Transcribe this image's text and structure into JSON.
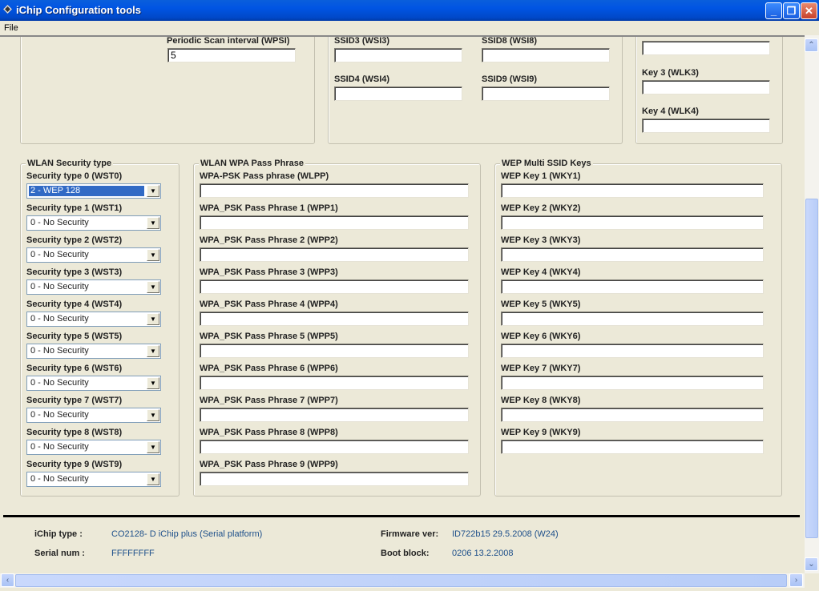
{
  "window": {
    "title": "iChip Configuration tools",
    "minimize": "_",
    "maximize": "❐",
    "close": "✕"
  },
  "menu": {
    "file": "File"
  },
  "top": {
    "scan_label": "Periodic Scan interval (WPSI)",
    "scan_value": "5",
    "ssid3": "SSID3 (WSI3)",
    "ssid8": "SSID8 (WSI8)",
    "ssid4": "SSID4 (WSI4)",
    "ssid9": "SSID9 (WSI9)",
    "key3": "Key 3 (WLK3)",
    "key4": "Key 4 (WLK4)"
  },
  "security": {
    "title": "WLAN Security type",
    "items": [
      {
        "label": "Security type 0 (WST0)",
        "value": "2 - WEP 128"
      },
      {
        "label": "Security type 1 (WST1)",
        "value": "0 - No Security"
      },
      {
        "label": "Security type 2 (WST2)",
        "value": "0 - No Security"
      },
      {
        "label": "Security type 3 (WST3)",
        "value": "0 - No Security"
      },
      {
        "label": "Security type 4 (WST4)",
        "value": "0 - No Security"
      },
      {
        "label": "Security type 5 (WST5)",
        "value": "0 - No Security"
      },
      {
        "label": "Security type 6 (WST6)",
        "value": "0 - No Security"
      },
      {
        "label": "Security type 7 (WST7)",
        "value": "0 - No Security"
      },
      {
        "label": "Security type 8 (WST8)",
        "value": "0 - No Security"
      },
      {
        "label": "Security type 9 (WST9)",
        "value": "0 - No Security"
      }
    ]
  },
  "wpa": {
    "title": "WLAN WPA Pass Phrase",
    "items": [
      {
        "label": "WPA-PSK Pass phrase (WLPP)",
        "value": ""
      },
      {
        "label": "WPA_PSK Pass Phrase 1 (WPP1)",
        "value": ""
      },
      {
        "label": "WPA_PSK Pass Phrase 2 (WPP2)",
        "value": ""
      },
      {
        "label": "WPA_PSK Pass Phrase 3 (WPP3)",
        "value": ""
      },
      {
        "label": "WPA_PSK Pass Phrase 4 (WPP4)",
        "value": ""
      },
      {
        "label": "WPA_PSK Pass Phrase 5 (WPP5)",
        "value": ""
      },
      {
        "label": "WPA_PSK Pass Phrase 6 (WPP6)",
        "value": ""
      },
      {
        "label": "WPA_PSK Pass Phrase 7 (WPP7)",
        "value": ""
      },
      {
        "label": "WPA_PSK Pass Phrase 8 (WPP8)",
        "value": ""
      },
      {
        "label": "WPA_PSK Pass Phrase 9 (WPP9)",
        "value": ""
      }
    ]
  },
  "wep": {
    "title": "WEP Multi SSID Keys",
    "items": [
      {
        "label": "WEP Key 1 (WKY1)",
        "value": ""
      },
      {
        "label": "WEP Key 2 (WKY2)",
        "value": ""
      },
      {
        "label": "WEP Key 3 (WKY3)",
        "value": ""
      },
      {
        "label": "WEP Key 4 (WKY4)",
        "value": ""
      },
      {
        "label": "WEP Key 5 (WKY5)",
        "value": ""
      },
      {
        "label": "WEP Key 6 (WKY6)",
        "value": ""
      },
      {
        "label": "WEP Key 7 (WKY7)",
        "value": ""
      },
      {
        "label": "WEP Key 8 (WKY8)",
        "value": ""
      },
      {
        "label": "WEP Key 9 (WKY9)",
        "value": ""
      }
    ]
  },
  "footer": {
    "ichip_type_label": "iChip type :",
    "ichip_type": "CO2128- D iChip plus (Serial platform)",
    "serial_label": "Serial num :",
    "serial": "FFFFFFFF",
    "firmware_label": "Firmware ver:",
    "firmware": "ID722b15 29.5.2008 (W24)",
    "boot_label": "Boot block:",
    "boot": "0206 13.2.2008"
  },
  "colors": {
    "titlebar": "#0054e3",
    "selection": "#316ac5",
    "footer_value": "#1d4f8a"
  }
}
